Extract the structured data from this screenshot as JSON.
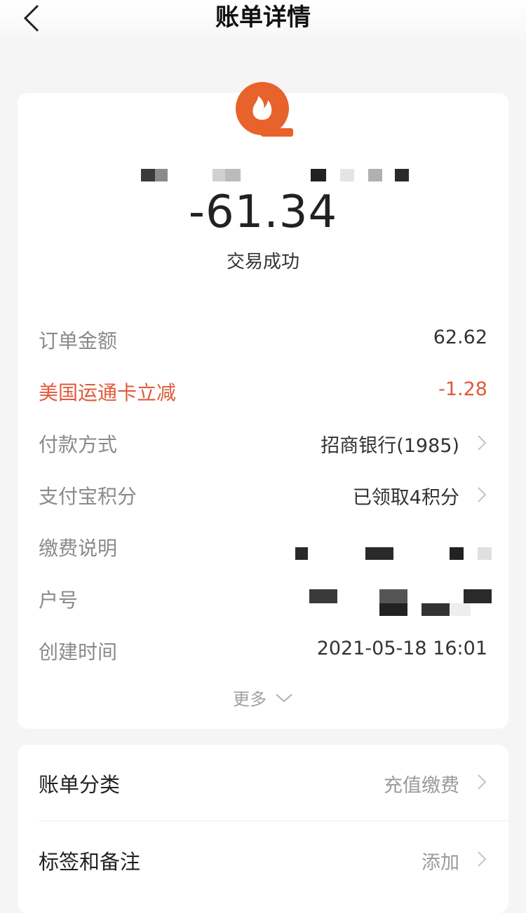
{
  "nav": {
    "title": "账单详情"
  },
  "summary": {
    "amount": "-61.34",
    "status": "交易成功"
  },
  "details": [
    {
      "label": "订单金额",
      "value": "62.62"
    },
    {
      "label": "美国运通卡立减",
      "value": "-1.28"
    },
    {
      "label": "付款方式",
      "value": "招商银行(1985)"
    },
    {
      "label": "支付宝积分",
      "value": "已领取4积分"
    },
    {
      "label": "缴费说明",
      "value": ""
    },
    {
      "label": "户号",
      "value": ""
    },
    {
      "label": "创建时间",
      "value": "2021-05-18 16:01"
    }
  ],
  "more_label": "更多",
  "extra": [
    {
      "label": "账单分类",
      "value": "充值缴费"
    },
    {
      "label": "标签和备注",
      "value": "添加"
    }
  ],
  "colors": {
    "accent_orange": "#e8622c",
    "discount_red": "#e05a3a"
  },
  "icons": {
    "back": "chevron-left-icon",
    "logo": "flame-q-logo",
    "row_arrow": "chevron-right-icon",
    "more": "chevron-down-icon"
  }
}
